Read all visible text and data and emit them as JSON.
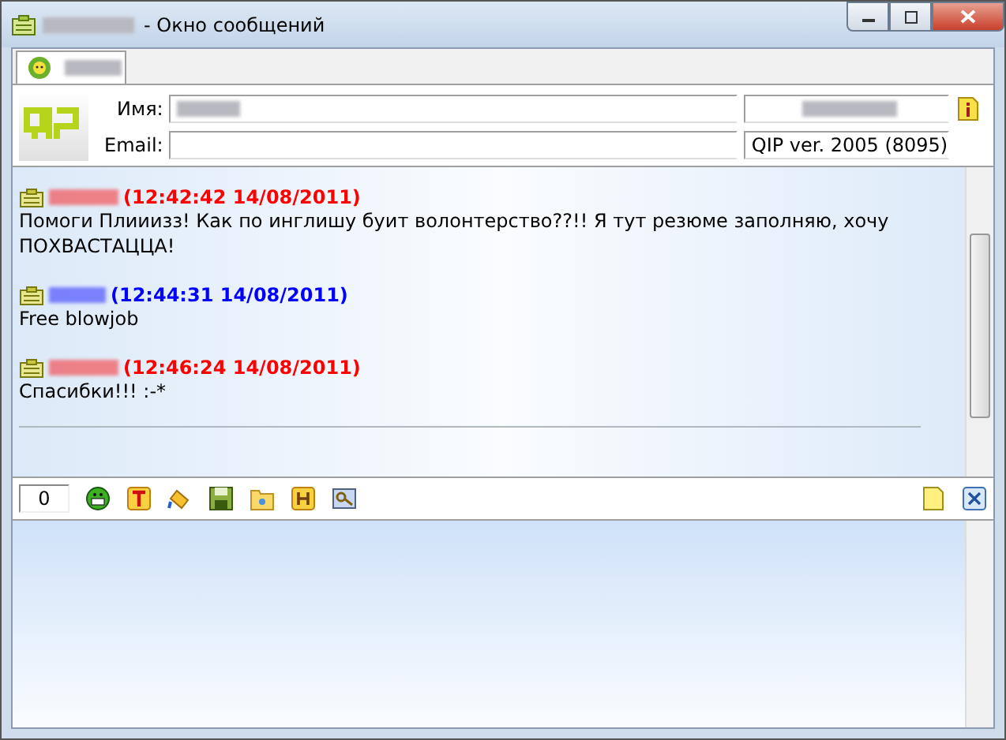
{
  "window": {
    "title": "- Окно сообщений"
  },
  "info": {
    "name_label": "Имя:",
    "email_label": "Email:",
    "version": "QIP ver. 2005 (8095)"
  },
  "messages": [
    {
      "color": "#ff0000",
      "timestamp": "(12:42:42 14/08/2011)",
      "text": "Помоги Плииизз! Как по инглишу буит волонтерство??!! Я тут резюме заполняю, хочу ПОХВАСТАЦЦА!"
    },
    {
      "color": "#0000ff",
      "timestamp": "(12:44:31 14/08/2011)",
      "text": "Free blowjob"
    },
    {
      "color": "#ff0000",
      "timestamp": "(12:46:24 14/08/2011)",
      "text": "Спасибки!!! :-*"
    }
  ],
  "toolbar": {
    "counter": "0"
  }
}
